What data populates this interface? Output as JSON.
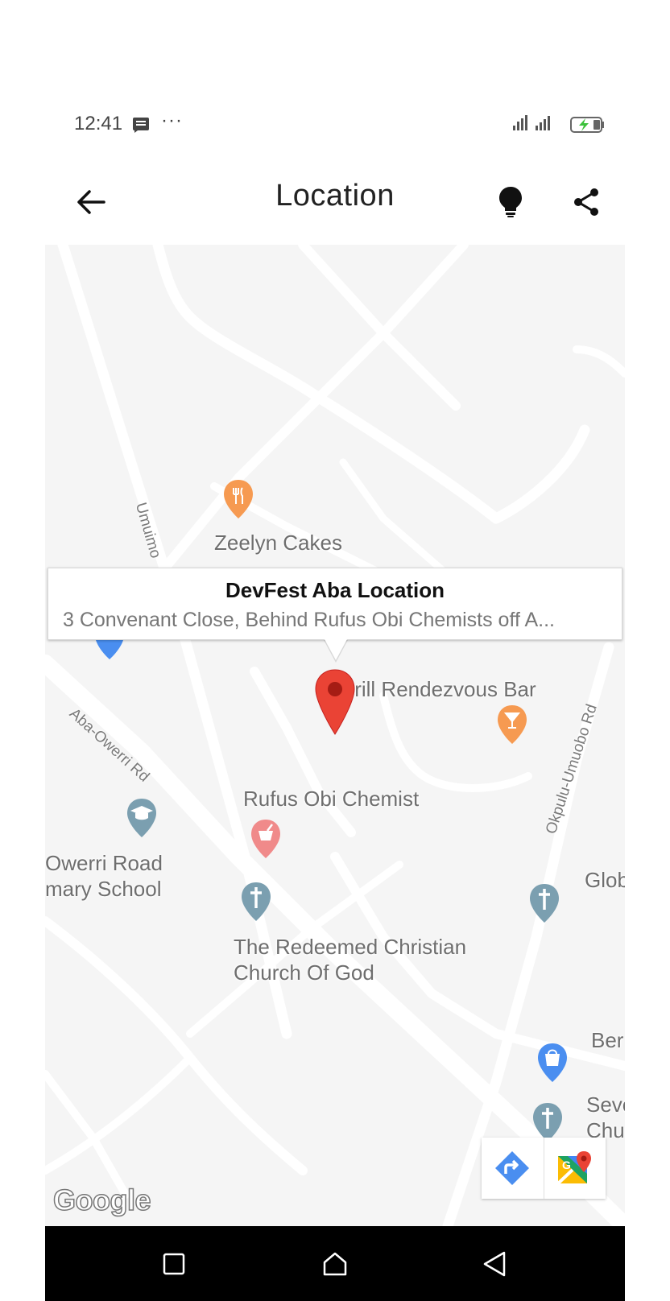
{
  "status_bar": {
    "time": "12:41",
    "dots": "···",
    "icons": [
      "message-icon",
      "signal-icon",
      "battery-charging-icon"
    ]
  },
  "app_bar": {
    "title": "Location",
    "icons": [
      "back-arrow-icon",
      "lightbulb-icon",
      "share-icon"
    ]
  },
  "map": {
    "info_window": {
      "title": "DevFest Aba Location",
      "snippet": "3 Convenant Close, Behind Rufus Obi Chemists off A..."
    },
    "places": {
      "zeelyn": "Zeelyn Cakes",
      "grill": "Grill Rendezvous Bar",
      "rufus": "Rufus Obi Chemist",
      "school_line1": "Owerri Road",
      "school_line2": "mary School",
      "church_line1": "The Redeemed Christian",
      "church_line2": "Church Of God",
      "glob": "Glob",
      "ber": "Ber",
      "sev_line1": "Seve",
      "sev_line2": "Chu"
    },
    "roads": {
      "umuimo": "Umuimo",
      "aba_owerri": "Aba-Owerri Rd",
      "okpulu": "Okpulu-Umuobo Rd"
    },
    "logo": "Google",
    "toolbar_icons": [
      "directions-icon",
      "google-maps-icon"
    ]
  },
  "nav_bar": {
    "icons": [
      "recents-square-icon",
      "home-icon",
      "back-triangle-icon"
    ]
  },
  "colors": {
    "map_background": "#f5f5f5",
    "road": "#ffffff",
    "pin_red": "#ea4335",
    "poi_orange": "#f69a51",
    "poi_blue_grey": "#7b9fb0",
    "poi_pink": "#f08a8a",
    "poi_blue": "#4a8ef0"
  }
}
